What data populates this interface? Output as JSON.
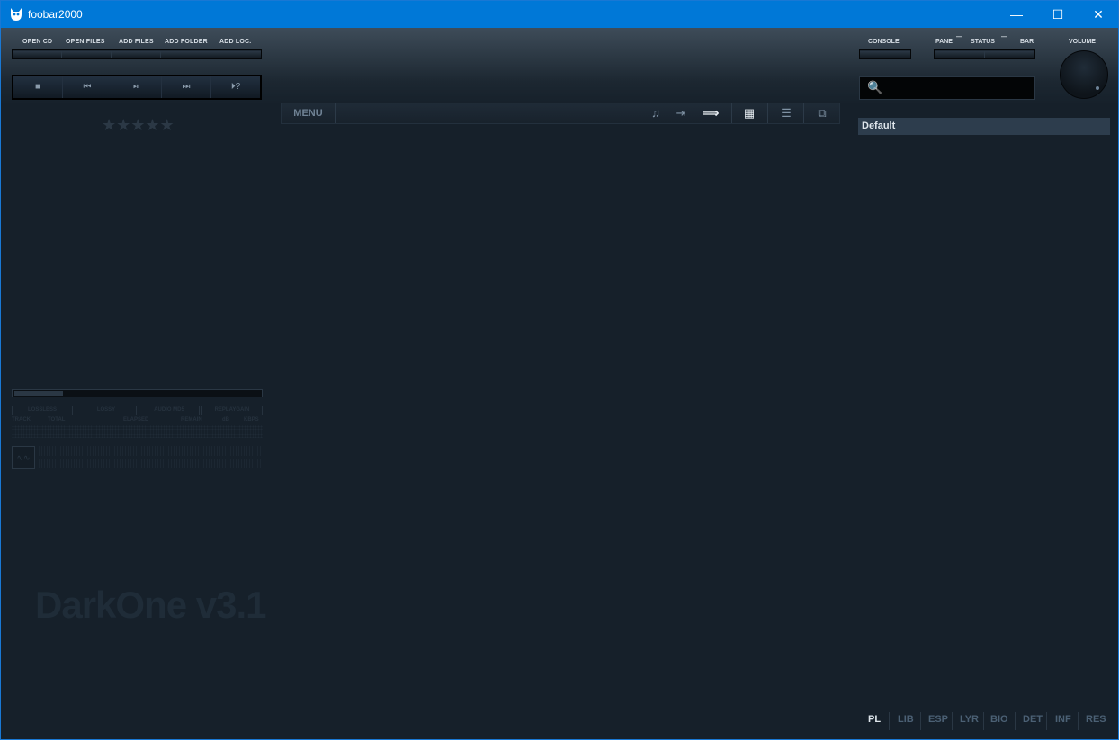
{
  "window": {
    "title": "foobar2000"
  },
  "titlebar": {
    "min": "—",
    "max": "☐",
    "close": "✕"
  },
  "top_buttons": [
    "OPEN CD",
    "OPEN FILES",
    "ADD FILES",
    "ADD FOLDER",
    "ADD LOC."
  ],
  "transport": [
    "■",
    "⏮",
    "⏯",
    "⏭",
    "⏵?"
  ],
  "rating": {
    "stars": "★★★★★",
    "value": 0,
    "max": 5
  },
  "format_boxes": [
    "LOSSLESS",
    "LOSSY",
    "AUDIO MD5",
    "REPLAYGAIN"
  ],
  "info_labels": [
    "TRACK",
    "TOTAL",
    "ELAPSED",
    "REMAIN",
    "dB",
    "KBPS"
  ],
  "watermark": "DarkOne v3.1",
  "midbar": {
    "menu": "MENU",
    "icons": [
      "♫",
      "⇥",
      "⟹",
      "▦",
      "☰",
      "⧉"
    ]
  },
  "right_labels": {
    "console": "CONSOLE",
    "pane": "PANE",
    "status": "STATUS",
    "bar": "BAR",
    "volume": "VOLUME"
  },
  "search": {
    "icon": "🔍",
    "placeholder": ""
  },
  "playlist": {
    "name": "Default"
  },
  "tabs": [
    "PL",
    "LIB",
    "ESP",
    "LYR",
    "BIO",
    "DET",
    "INF",
    "RES"
  ],
  "active_tab": "PL",
  "colors": {
    "titlebar": "#0078d7",
    "background": "#16202a",
    "accent": "#2d3d4d"
  }
}
